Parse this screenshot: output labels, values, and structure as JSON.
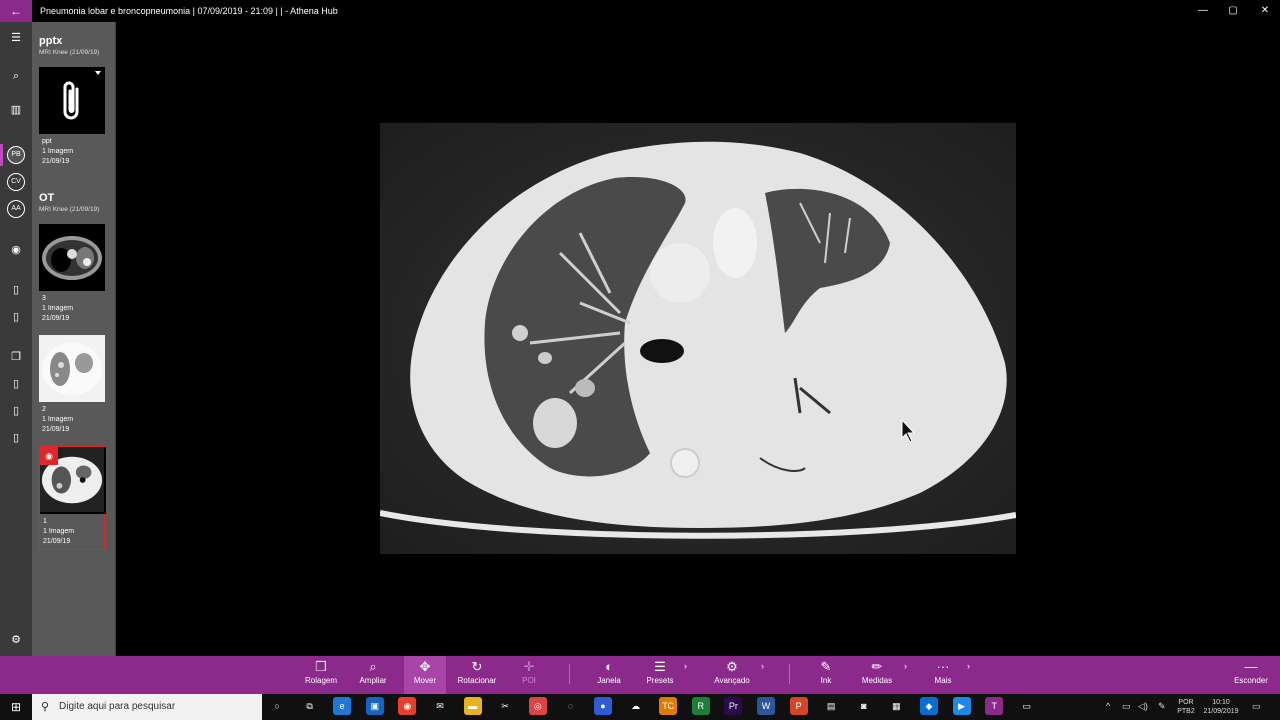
{
  "window": {
    "title": "Pneumonia lobar e broncopneumonia | 07/09/2019 - 21:09 |  | - Athena Hub",
    "back_icon": "back-arrow-icon",
    "minimize": "—",
    "maximize": "▢",
    "close": "✕",
    "viewer_close": "✕"
  },
  "sidebar_icons": {
    "menu": "☰",
    "search": "⌕",
    "library": "▥",
    "avatars": [
      "PB",
      "CV",
      "AA"
    ],
    "eye": "◉",
    "doc1": "▯",
    "doc2": "▯",
    "copy": "❐",
    "doc3": "▯",
    "doc4": "▯",
    "doc5": "▯",
    "settings": "⚙"
  },
  "groups": [
    {
      "name": "pptx",
      "subtitle": "MRI Knee (21/09/19)",
      "items": [
        {
          "label": "ppt",
          "count": "1 Imagem",
          "date": "21/09/19",
          "kind": "attachment"
        }
      ]
    },
    {
      "name": "OT",
      "subtitle": "MRI Knee (21/09/19)",
      "items": [
        {
          "label": "3",
          "count": "1 Imagem",
          "date": "21/09/19",
          "kind": "ct-mediastinal"
        },
        {
          "label": "2",
          "count": "1 Imagem",
          "date": "21/09/19",
          "kind": "ct-lung-light"
        },
        {
          "label": "1",
          "count": "1 Imagem",
          "date": "21/09/19",
          "kind": "ct-lung",
          "selected": true
        }
      ]
    }
  ],
  "toolbar": {
    "tools": [
      {
        "name": "Rolagem",
        "icon": "❐"
      },
      {
        "name": "Ampliar",
        "icon": "⌕"
      },
      {
        "name": "Mover",
        "icon": "✥",
        "active": true
      },
      {
        "name": "Rotacionar",
        "icon": "↻"
      },
      {
        "name": "POI",
        "icon": "✛",
        "disabled": true
      },
      {
        "name": "Janela",
        "icon": "◐"
      },
      {
        "name": "Presets",
        "icon": "☰"
      },
      {
        "name": "Avançado",
        "icon": "⚙"
      },
      {
        "name": "Ink",
        "icon": "✎"
      },
      {
        "name": "Medidas",
        "icon": "✏"
      },
      {
        "name": "Mais",
        "icon": "···"
      }
    ],
    "hide": {
      "name": "Esconder",
      "icon": "—"
    },
    "chevron": "›"
  },
  "taskbar": {
    "start": "⊞",
    "search_placeholder": "Digite aqui para pesquisar",
    "search_icon": "⚲",
    "apps": [
      {
        "icon": "○",
        "color": "#101010"
      },
      {
        "icon": "⧉",
        "color": "#101010"
      },
      {
        "icon": "e",
        "color": "#1e78d4"
      },
      {
        "icon": "▣",
        "color": "#1565c0"
      },
      {
        "icon": "◉",
        "color": "#e4412c"
      },
      {
        "icon": "✉",
        "color": "#101010"
      },
      {
        "icon": "▬",
        "color": "#e6b422"
      },
      {
        "icon": "✂",
        "color": "#101010"
      },
      {
        "icon": "◎",
        "color": "#d44"
      },
      {
        "icon": "◌",
        "color": "#101010"
      },
      {
        "icon": "●",
        "color": "#2f5bd3"
      },
      {
        "icon": "☁",
        "color": "#101010"
      },
      {
        "icon": "TC",
        "color": "#e07b00"
      },
      {
        "icon": "R",
        "color": "#1f7d3a"
      },
      {
        "icon": "Pr",
        "color": "#2a0a4a"
      },
      {
        "icon": "W",
        "color": "#2b579a"
      },
      {
        "icon": "P",
        "color": "#d24726"
      },
      {
        "icon": "▤",
        "color": "#101010"
      },
      {
        "icon": "◙",
        "color": "#101010"
      },
      {
        "icon": "▦",
        "color": "#101010"
      },
      {
        "icon": "◆",
        "color": "#0a6ed1"
      },
      {
        "icon": "▶",
        "color": "#1e88e5"
      },
      {
        "icon": "T",
        "color": "#8c2a8c"
      },
      {
        "icon": "▭",
        "color": "#101010"
      }
    ],
    "tray": {
      "chevron": "^",
      "lang1": "POR",
      "lang2": "PTB2",
      "time": "10:10",
      "date": "21/09/2019",
      "notif": "▭"
    }
  }
}
